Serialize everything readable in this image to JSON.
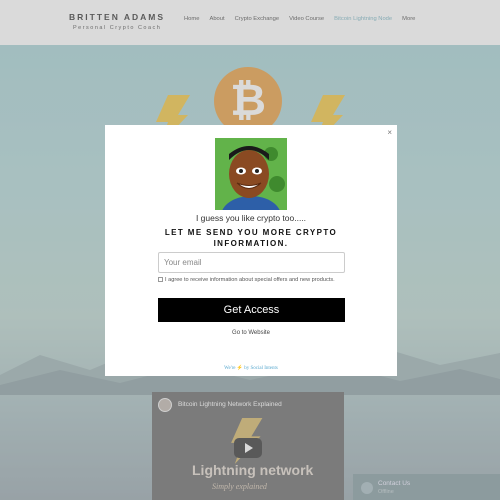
{
  "header": {
    "brand": "BRITTEN ADAMS",
    "tagline": "Personal Crypto Coach",
    "nav": [
      "Home",
      "About",
      "Crypto Exchange",
      "Video Course",
      "Bitcoin Lightning Node",
      "More"
    ],
    "active_nav_index": 4
  },
  "hero": {
    "coin_symbol": "₿"
  },
  "video": {
    "title": "Bitcoin Lightning Network Explained",
    "heading": "Lightning network",
    "subheading": "Simply explained"
  },
  "chat": {
    "title": "Contact Us",
    "subtitle": "Offline"
  },
  "modal": {
    "close_symbol": "×",
    "intro": "I guess you like crypto too.....",
    "heading": "LET ME SEND YOU MORE CRYPTO INFORMATION.",
    "email_placeholder": "Your email",
    "consent": "I agree to receive information about special offers and new products.",
    "cta_label": "Get Access",
    "goto_label": "Go to Website",
    "powered_by": "We're ⚡ by Social Intents"
  },
  "colors": {
    "accent_nav": "#7fb8c6",
    "coin": "#e8a046",
    "bolt": "#f2c744",
    "cta_bg": "#000000"
  }
}
